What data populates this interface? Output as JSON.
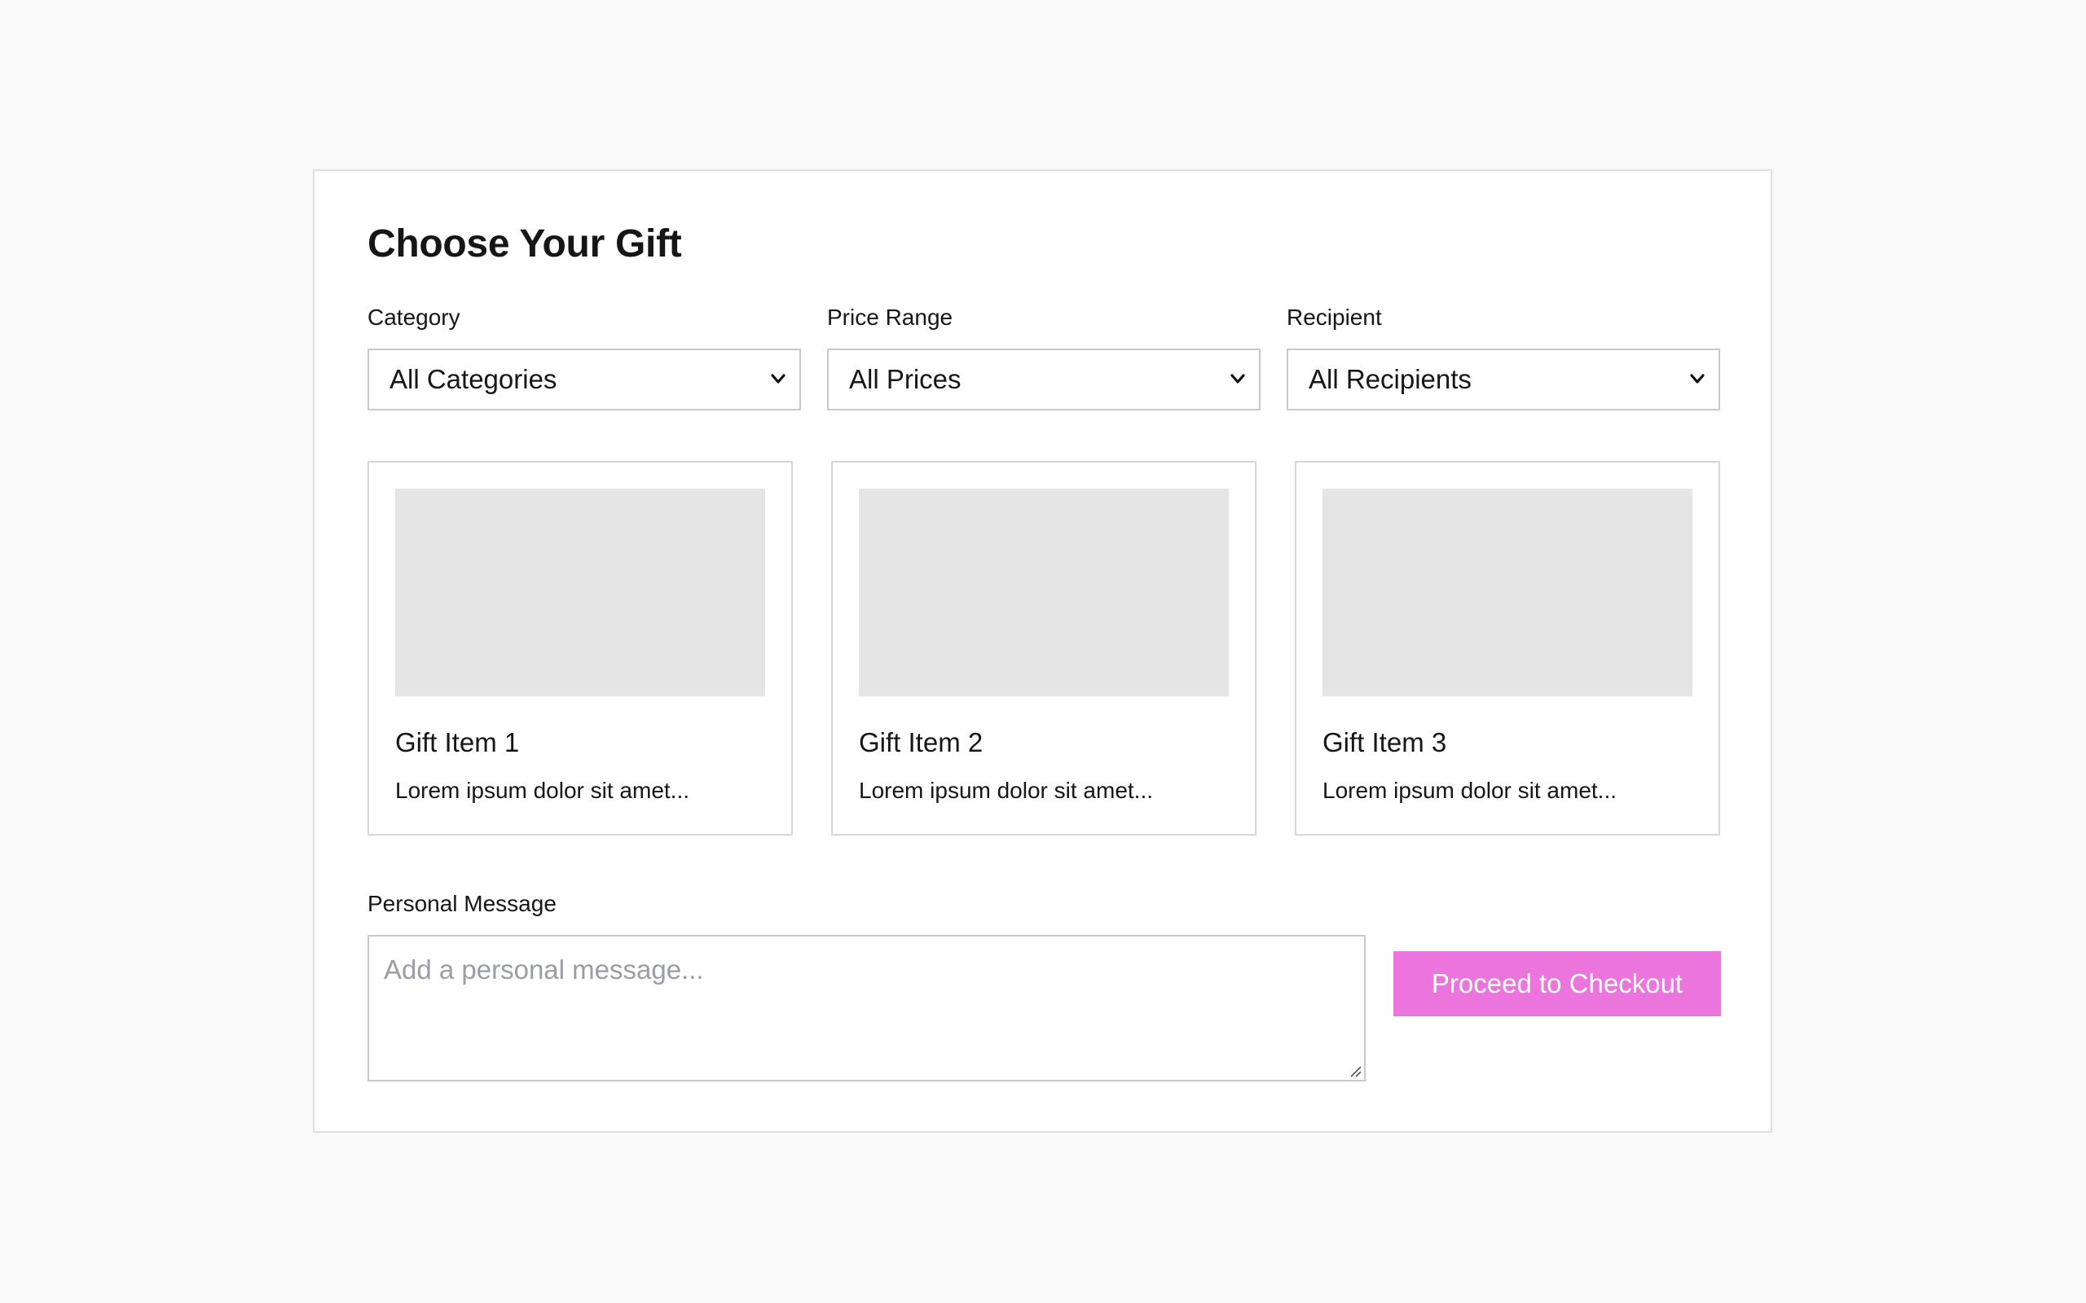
{
  "page": {
    "title": "Choose Your Gift"
  },
  "filters": [
    {
      "label": "Category",
      "selected": "All Categories"
    },
    {
      "label": "Price Range",
      "selected": "All Prices"
    },
    {
      "label": "Recipient",
      "selected": "All Recipients"
    }
  ],
  "gifts": [
    {
      "name": "Gift Item 1",
      "description": "Lorem ipsum dolor sit amet..."
    },
    {
      "name": "Gift Item 2",
      "description": "Lorem ipsum dolor sit amet..."
    },
    {
      "name": "Gift Item 3",
      "description": "Lorem ipsum dolor sit amet..."
    }
  ],
  "message": {
    "label": "Personal Message",
    "placeholder": "Add a personal message...",
    "value": ""
  },
  "checkout": {
    "label": "Proceed to Checkout"
  },
  "colors": {
    "background": "#f9f9f9",
    "panel": "#ffffff",
    "image_placeholder": "#e5e5e5",
    "accent": "#ec74dd",
    "placeholder_text": "#9a9ca6"
  }
}
